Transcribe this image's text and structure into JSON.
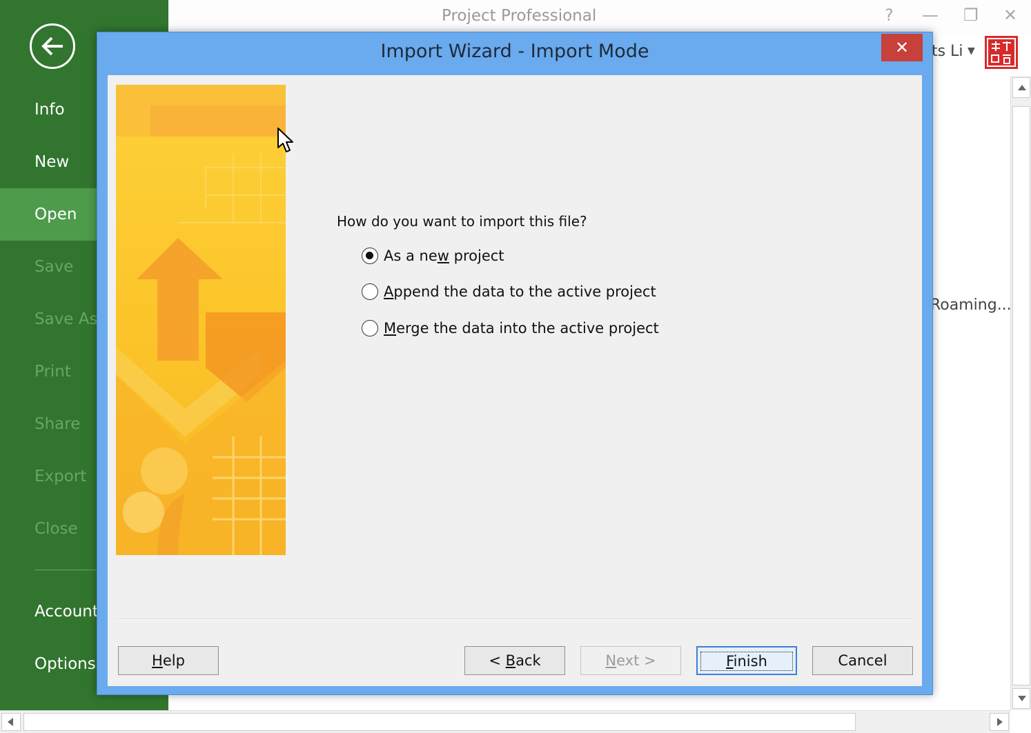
{
  "app": {
    "title": "Project Professional",
    "window_controls": {
      "help": "?",
      "minimize": "—",
      "maximize": "❐",
      "close": "✕"
    },
    "user_name": "ts Li",
    "background_text": "Roaming..."
  },
  "sidebar": {
    "items": [
      {
        "label": "Info",
        "state": "enabled"
      },
      {
        "label": "New",
        "state": "enabled"
      },
      {
        "label": "Open",
        "state": "selected"
      },
      {
        "label": "Save",
        "state": "disabled"
      },
      {
        "label": "Save As",
        "state": "disabled"
      },
      {
        "label": "Print",
        "state": "disabled"
      },
      {
        "label": "Share",
        "state": "disabled"
      },
      {
        "label": "Export",
        "state": "disabled"
      },
      {
        "label": "Close",
        "state": "disabled"
      },
      {
        "label": "Account",
        "state": "enabled"
      },
      {
        "label": "Options",
        "state": "enabled"
      }
    ]
  },
  "dialog": {
    "title": "Import Wizard - Import Mode",
    "close_glyph": "✕",
    "question": "How do you want to import this file?",
    "options": [
      {
        "label_pre": "As a ne",
        "label_key": "w",
        "label_post": " project",
        "checked": true
      },
      {
        "label_pre": "",
        "label_key": "A",
        "label_post": "ppend the data to the active project",
        "checked": false
      },
      {
        "label_pre": "",
        "label_key": "M",
        "label_post": "erge the data into the active project",
        "checked": false
      }
    ],
    "buttons": {
      "help": {
        "pre": "",
        "key": "H",
        "post": "elp"
      },
      "back": {
        "pre": "< ",
        "key": "B",
        "post": "ack"
      },
      "next": {
        "pre": "",
        "key": "N",
        "post": "ext >"
      },
      "finish": {
        "pre": "",
        "key": "F",
        "post": "inish"
      },
      "cancel": {
        "label": "Cancel"
      }
    }
  },
  "colors": {
    "sidebar_bg": "#31752f",
    "sidebar_selected": "#4e9b4c",
    "dialog_frame": "#6aaaee",
    "dialog_close": "#c7403a"
  }
}
